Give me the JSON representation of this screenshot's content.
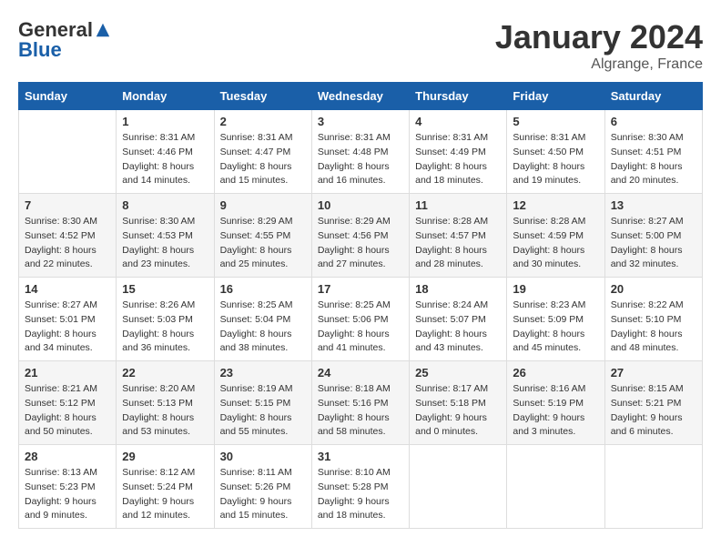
{
  "header": {
    "logo": {
      "general": "General",
      "blue": "Blue"
    },
    "title": "January 2024",
    "location": "Algrange, France"
  },
  "days_of_week": [
    "Sunday",
    "Monday",
    "Tuesday",
    "Wednesday",
    "Thursday",
    "Friday",
    "Saturday"
  ],
  "weeks": [
    [
      {
        "day": "",
        "sunrise": "",
        "sunset": "",
        "daylight": ""
      },
      {
        "day": "1",
        "sunrise": "Sunrise: 8:31 AM",
        "sunset": "Sunset: 4:46 PM",
        "daylight": "Daylight: 8 hours and 14 minutes."
      },
      {
        "day": "2",
        "sunrise": "Sunrise: 8:31 AM",
        "sunset": "Sunset: 4:47 PM",
        "daylight": "Daylight: 8 hours and 15 minutes."
      },
      {
        "day": "3",
        "sunrise": "Sunrise: 8:31 AM",
        "sunset": "Sunset: 4:48 PM",
        "daylight": "Daylight: 8 hours and 16 minutes."
      },
      {
        "day": "4",
        "sunrise": "Sunrise: 8:31 AM",
        "sunset": "Sunset: 4:49 PM",
        "daylight": "Daylight: 8 hours and 18 minutes."
      },
      {
        "day": "5",
        "sunrise": "Sunrise: 8:31 AM",
        "sunset": "Sunset: 4:50 PM",
        "daylight": "Daylight: 8 hours and 19 minutes."
      },
      {
        "day": "6",
        "sunrise": "Sunrise: 8:30 AM",
        "sunset": "Sunset: 4:51 PM",
        "daylight": "Daylight: 8 hours and 20 minutes."
      }
    ],
    [
      {
        "day": "7",
        "sunrise": "Sunrise: 8:30 AM",
        "sunset": "Sunset: 4:52 PM",
        "daylight": "Daylight: 8 hours and 22 minutes."
      },
      {
        "day": "8",
        "sunrise": "Sunrise: 8:30 AM",
        "sunset": "Sunset: 4:53 PM",
        "daylight": "Daylight: 8 hours and 23 minutes."
      },
      {
        "day": "9",
        "sunrise": "Sunrise: 8:29 AM",
        "sunset": "Sunset: 4:55 PM",
        "daylight": "Daylight: 8 hours and 25 minutes."
      },
      {
        "day": "10",
        "sunrise": "Sunrise: 8:29 AM",
        "sunset": "Sunset: 4:56 PM",
        "daylight": "Daylight: 8 hours and 27 minutes."
      },
      {
        "day": "11",
        "sunrise": "Sunrise: 8:28 AM",
        "sunset": "Sunset: 4:57 PM",
        "daylight": "Daylight: 8 hours and 28 minutes."
      },
      {
        "day": "12",
        "sunrise": "Sunrise: 8:28 AM",
        "sunset": "Sunset: 4:59 PM",
        "daylight": "Daylight: 8 hours and 30 minutes."
      },
      {
        "day": "13",
        "sunrise": "Sunrise: 8:27 AM",
        "sunset": "Sunset: 5:00 PM",
        "daylight": "Daylight: 8 hours and 32 minutes."
      }
    ],
    [
      {
        "day": "14",
        "sunrise": "Sunrise: 8:27 AM",
        "sunset": "Sunset: 5:01 PM",
        "daylight": "Daylight: 8 hours and 34 minutes."
      },
      {
        "day": "15",
        "sunrise": "Sunrise: 8:26 AM",
        "sunset": "Sunset: 5:03 PM",
        "daylight": "Daylight: 8 hours and 36 minutes."
      },
      {
        "day": "16",
        "sunrise": "Sunrise: 8:25 AM",
        "sunset": "Sunset: 5:04 PM",
        "daylight": "Daylight: 8 hours and 38 minutes."
      },
      {
        "day": "17",
        "sunrise": "Sunrise: 8:25 AM",
        "sunset": "Sunset: 5:06 PM",
        "daylight": "Daylight: 8 hours and 41 minutes."
      },
      {
        "day": "18",
        "sunrise": "Sunrise: 8:24 AM",
        "sunset": "Sunset: 5:07 PM",
        "daylight": "Daylight: 8 hours and 43 minutes."
      },
      {
        "day": "19",
        "sunrise": "Sunrise: 8:23 AM",
        "sunset": "Sunset: 5:09 PM",
        "daylight": "Daylight: 8 hours and 45 minutes."
      },
      {
        "day": "20",
        "sunrise": "Sunrise: 8:22 AM",
        "sunset": "Sunset: 5:10 PM",
        "daylight": "Daylight: 8 hours and 48 minutes."
      }
    ],
    [
      {
        "day": "21",
        "sunrise": "Sunrise: 8:21 AM",
        "sunset": "Sunset: 5:12 PM",
        "daylight": "Daylight: 8 hours and 50 minutes."
      },
      {
        "day": "22",
        "sunrise": "Sunrise: 8:20 AM",
        "sunset": "Sunset: 5:13 PM",
        "daylight": "Daylight: 8 hours and 53 minutes."
      },
      {
        "day": "23",
        "sunrise": "Sunrise: 8:19 AM",
        "sunset": "Sunset: 5:15 PM",
        "daylight": "Daylight: 8 hours and 55 minutes."
      },
      {
        "day": "24",
        "sunrise": "Sunrise: 8:18 AM",
        "sunset": "Sunset: 5:16 PM",
        "daylight": "Daylight: 8 hours and 58 minutes."
      },
      {
        "day": "25",
        "sunrise": "Sunrise: 8:17 AM",
        "sunset": "Sunset: 5:18 PM",
        "daylight": "Daylight: 9 hours and 0 minutes."
      },
      {
        "day": "26",
        "sunrise": "Sunrise: 8:16 AM",
        "sunset": "Sunset: 5:19 PM",
        "daylight": "Daylight: 9 hours and 3 minutes."
      },
      {
        "day": "27",
        "sunrise": "Sunrise: 8:15 AM",
        "sunset": "Sunset: 5:21 PM",
        "daylight": "Daylight: 9 hours and 6 minutes."
      }
    ],
    [
      {
        "day": "28",
        "sunrise": "Sunrise: 8:13 AM",
        "sunset": "Sunset: 5:23 PM",
        "daylight": "Daylight: 9 hours and 9 minutes."
      },
      {
        "day": "29",
        "sunrise": "Sunrise: 8:12 AM",
        "sunset": "Sunset: 5:24 PM",
        "daylight": "Daylight: 9 hours and 12 minutes."
      },
      {
        "day": "30",
        "sunrise": "Sunrise: 8:11 AM",
        "sunset": "Sunset: 5:26 PM",
        "daylight": "Daylight: 9 hours and 15 minutes."
      },
      {
        "day": "31",
        "sunrise": "Sunrise: 8:10 AM",
        "sunset": "Sunset: 5:28 PM",
        "daylight": "Daylight: 9 hours and 18 minutes."
      },
      {
        "day": "",
        "sunrise": "",
        "sunset": "",
        "daylight": ""
      },
      {
        "day": "",
        "sunrise": "",
        "sunset": "",
        "daylight": ""
      },
      {
        "day": "",
        "sunrise": "",
        "sunset": "",
        "daylight": ""
      }
    ]
  ]
}
